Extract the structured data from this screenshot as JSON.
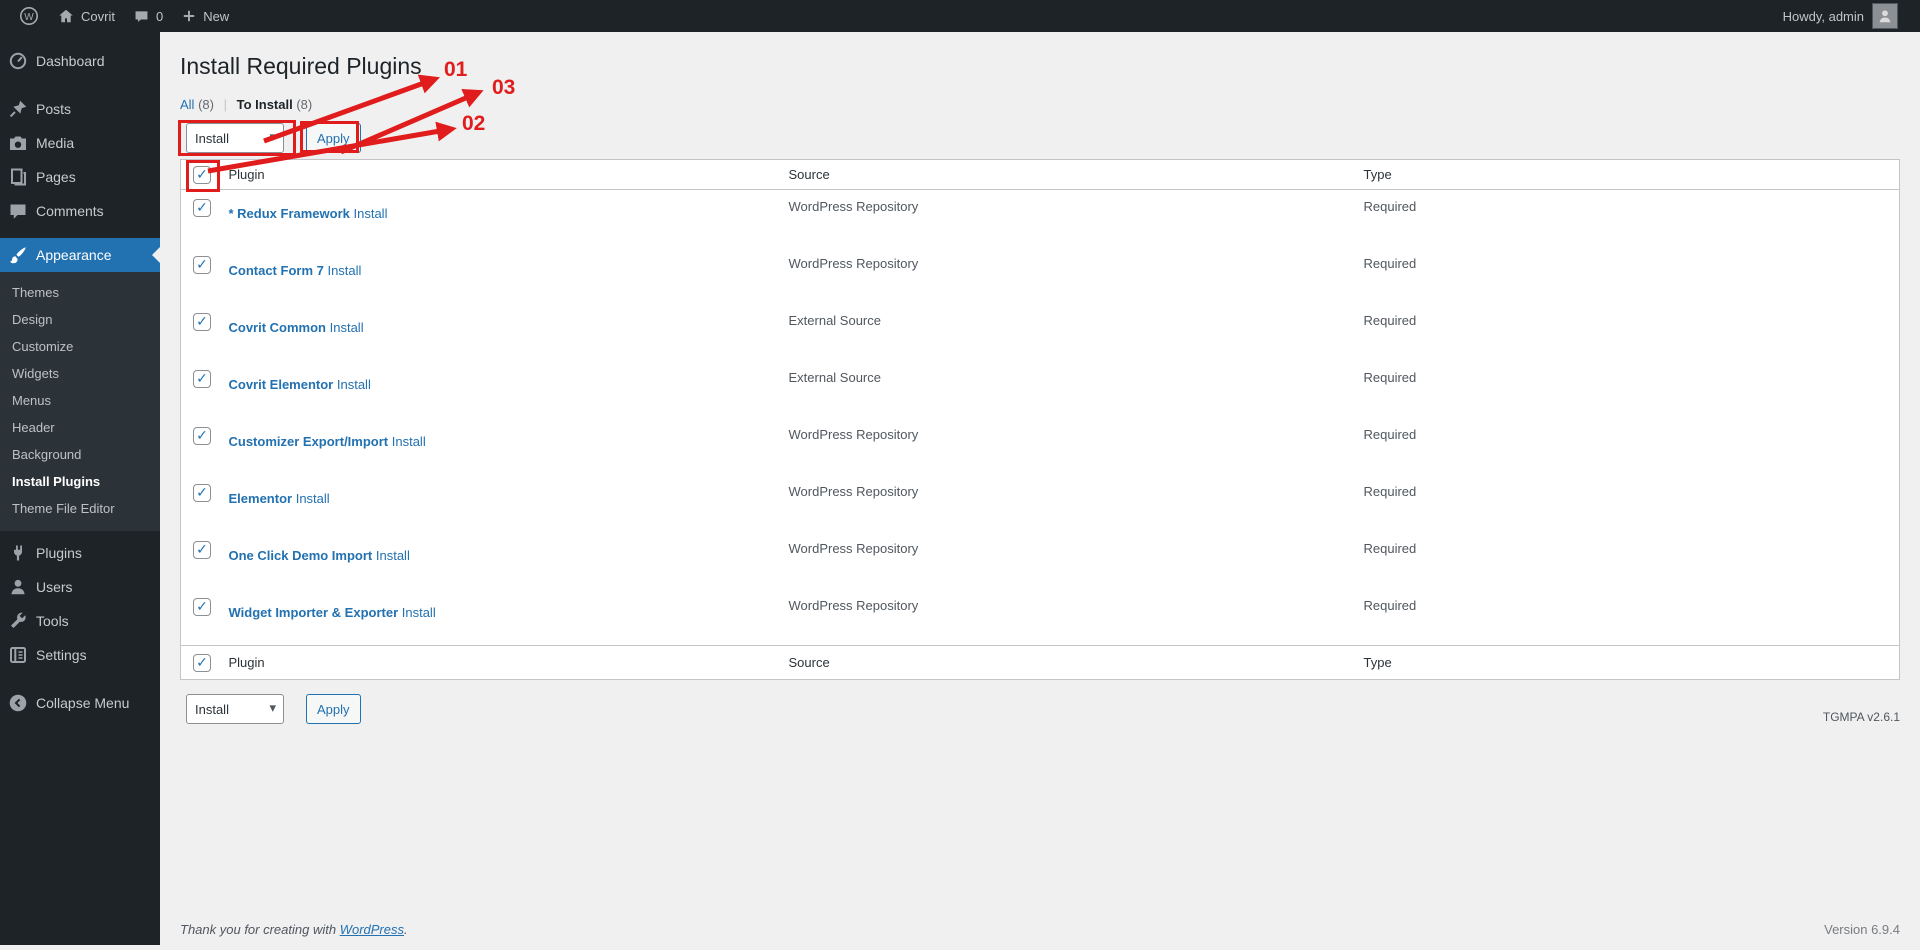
{
  "admin_bar": {
    "site_name": "Covrit",
    "comments_count": "0",
    "new_label": "New",
    "howdy": "Howdy, admin"
  },
  "sidebar": {
    "items": [
      {
        "label": "Dashboard",
        "icon": "dashboard-icon"
      },
      {
        "label": "Posts",
        "icon": "pushpin-icon"
      },
      {
        "label": "Media",
        "icon": "camera-icon"
      },
      {
        "label": "Pages",
        "icon": "pages-icon"
      },
      {
        "label": "Comments",
        "icon": "comment-icon"
      },
      {
        "label": "Appearance",
        "icon": "brush-icon"
      },
      {
        "label": "Plugins",
        "icon": "plug-icon"
      },
      {
        "label": "Users",
        "icon": "user-icon"
      },
      {
        "label": "Tools",
        "icon": "wrench-icon"
      },
      {
        "label": "Settings",
        "icon": "settings-icon"
      }
    ],
    "appearance_submenu": [
      "Themes",
      "Design",
      "Customize",
      "Widgets",
      "Menus",
      "Header",
      "Background",
      "Install Plugins",
      "Theme File Editor"
    ],
    "current_submenu_item": "Install Plugins",
    "collapse_label": "Collapse Menu"
  },
  "page": {
    "title": "Install Required Plugins",
    "filters": {
      "all_label": "All",
      "all_count": "(8)",
      "to_install_label": "To Install",
      "to_install_count": "(8)"
    },
    "bulk": {
      "action_selected": "Install",
      "apply_label": "Apply"
    },
    "table": {
      "columns": {
        "plugin": "Plugin",
        "source": "Source",
        "type": "Type"
      },
      "rows": [
        {
          "name": "* Redux Framework",
          "action": "Install",
          "source": "WordPress Repository",
          "type": "Required"
        },
        {
          "name": "Contact Form 7",
          "action": "Install",
          "source": "WordPress Repository",
          "type": "Required"
        },
        {
          "name": "Covrit Common",
          "action": "Install",
          "source": "External Source",
          "type": "Required"
        },
        {
          "name": "Covrit Elementor",
          "action": "Install",
          "source": "External Source",
          "type": "Required"
        },
        {
          "name": "Customizer Export/Import",
          "action": "Install",
          "source": "WordPress Repository",
          "type": "Required"
        },
        {
          "name": "Elementor",
          "action": "Install",
          "source": "WordPress Repository",
          "type": "Required"
        },
        {
          "name": "One Click Demo Import",
          "action": "Install",
          "source": "WordPress Repository",
          "type": "Required"
        },
        {
          "name": "Widget Importer & Exporter",
          "action": "Install",
          "source": "WordPress Repository",
          "type": "Required"
        }
      ]
    },
    "tgmpa_version": "TGMPA v2.6.1"
  },
  "annotations": {
    "labels": {
      "step1": "01",
      "step2": "02",
      "step3": "03"
    },
    "accent_color": "#e11c1c"
  },
  "footer": {
    "thanks_prefix": "Thank you for creating with ",
    "wordpress_link": "WordPress",
    "thanks_suffix": ".",
    "version": "Version 6.9.4"
  }
}
